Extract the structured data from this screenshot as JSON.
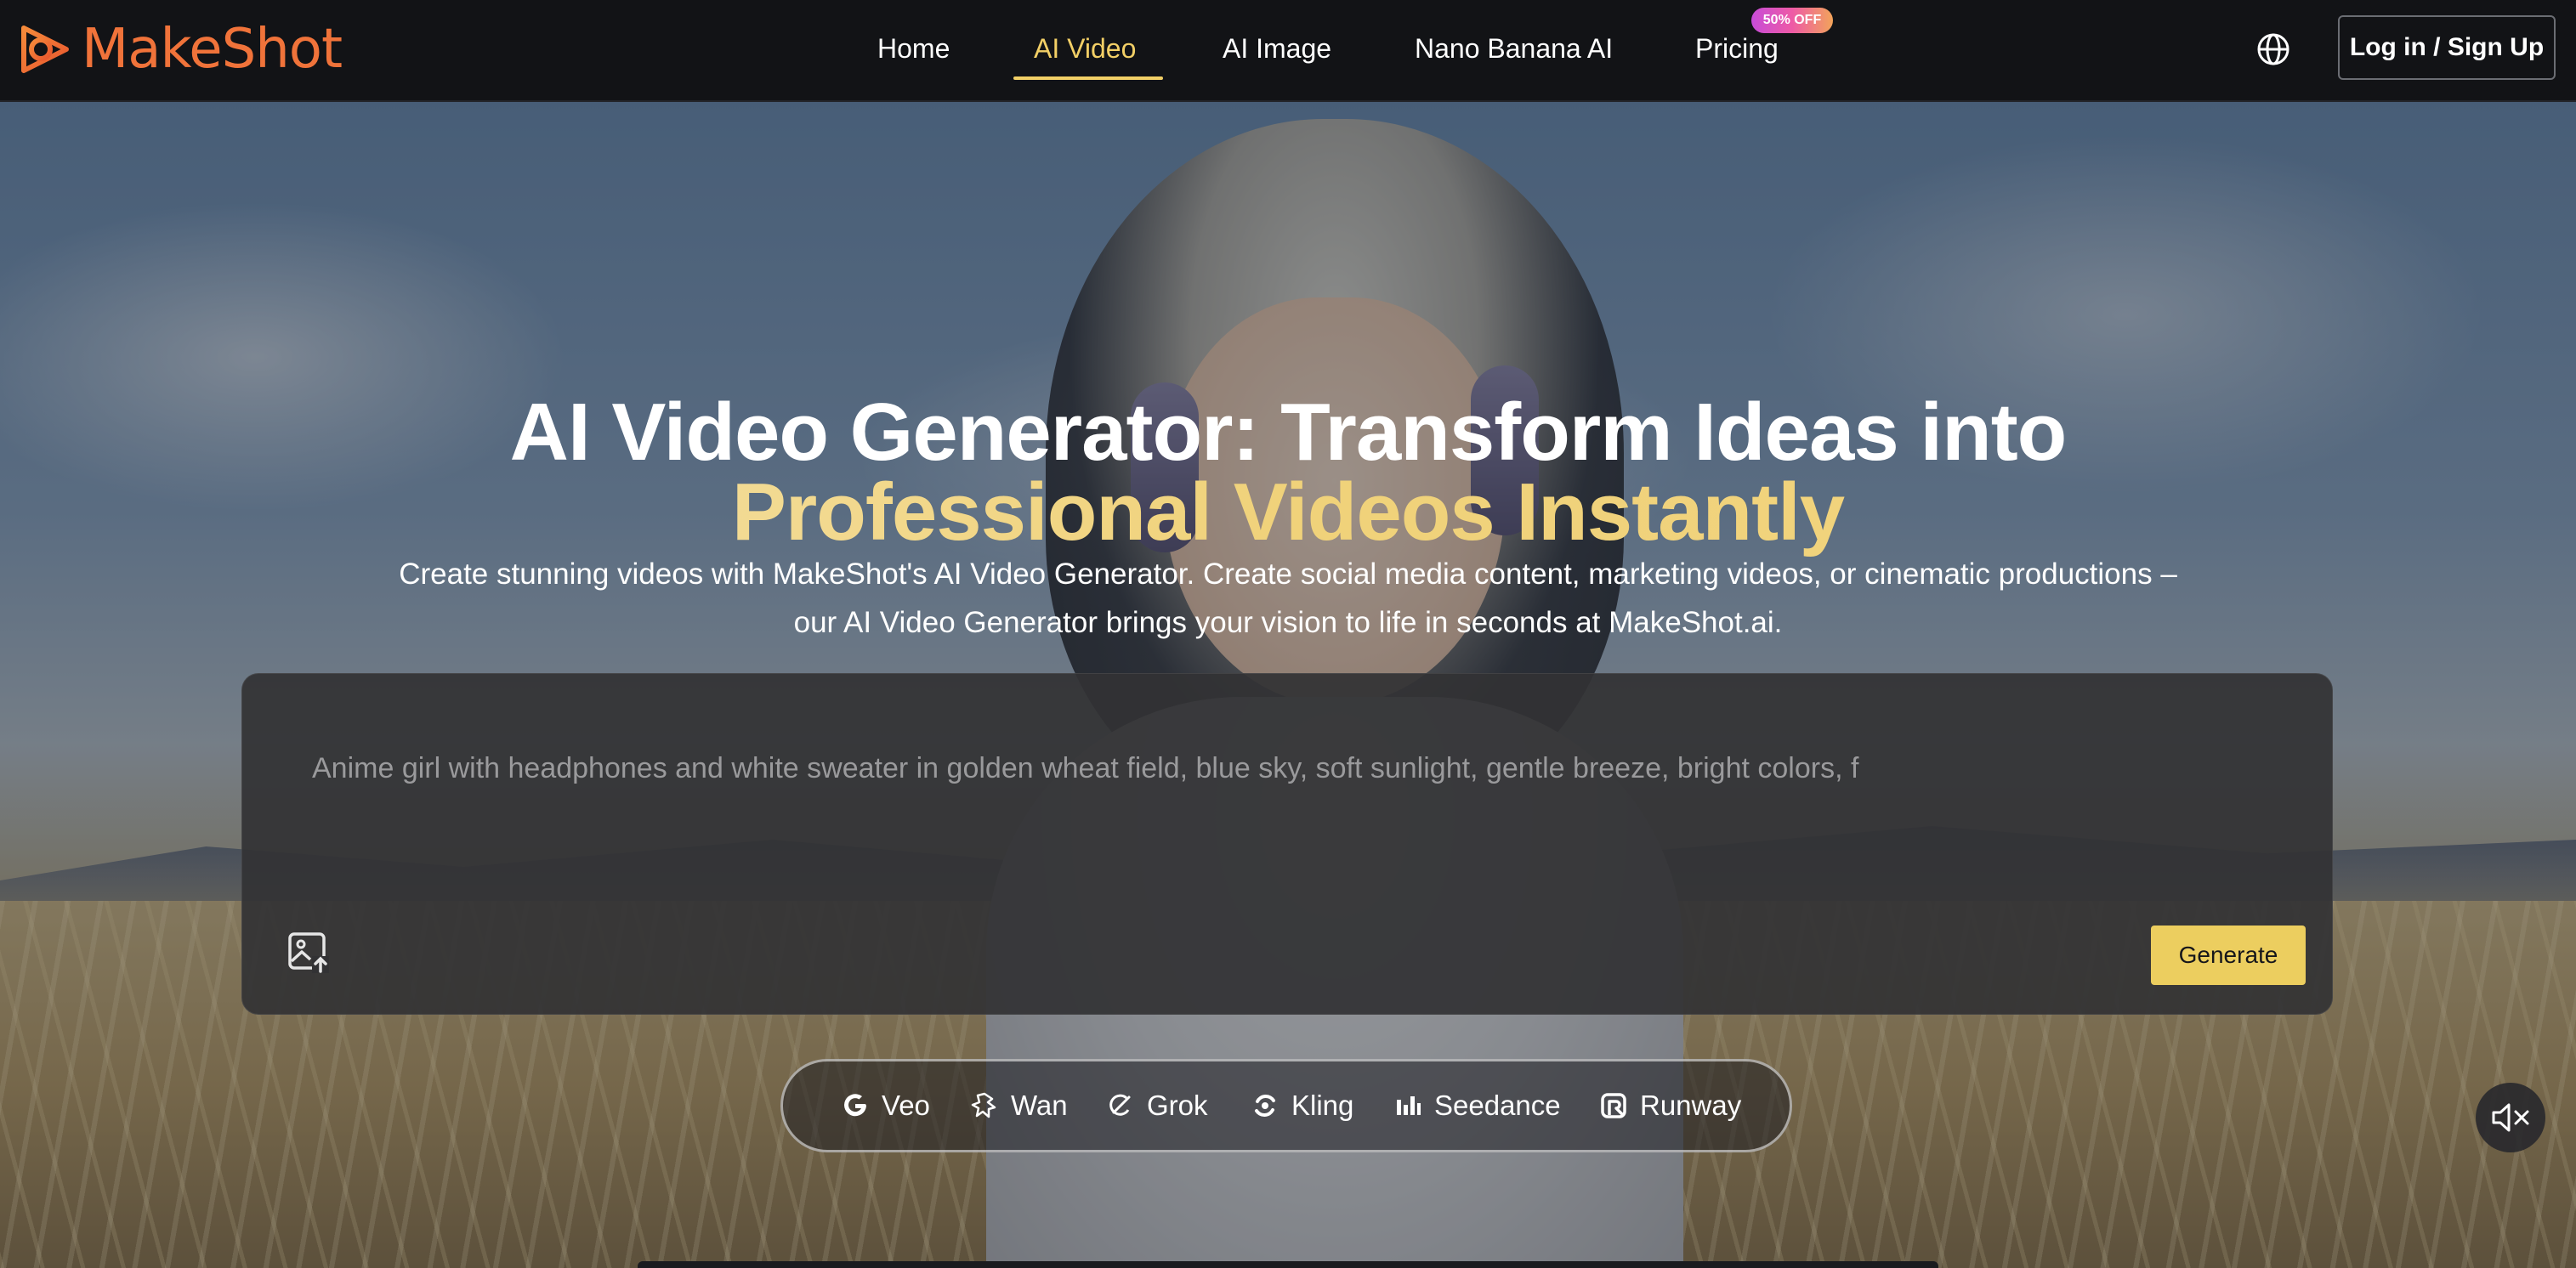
{
  "brand": {
    "name": "MakeShot"
  },
  "nav": {
    "items": [
      {
        "label": "Home"
      },
      {
        "label": "AI Video"
      },
      {
        "label": "AI Image"
      },
      {
        "label": "Nano Banana AI"
      },
      {
        "label": "Pricing"
      }
    ],
    "active": "AI Video",
    "pricing_badge": "50% OFF",
    "login_label": "Log in / Sign Up"
  },
  "hero": {
    "title_line1": "AI Video Generator: Transform Ideas into",
    "title_line2": "Professional Videos Instantly",
    "subtitle_line1": "Create stunning videos with MakeShot's AI Video Generator. Create social media content, marketing videos, or cinematic productions –",
    "subtitle_line2": "our AI Video Generator brings your vision to life in seconds at MakeShot.ai."
  },
  "prompt": {
    "placeholder": "Anime girl with headphones and white sweater in golden wheat field, blue sky, soft sunlight, gentle breeze, bright colors, f",
    "generate_label": "Generate"
  },
  "models": [
    {
      "label": "Veo",
      "icon": "google-icon"
    },
    {
      "label": "Wan",
      "icon": "wan-icon"
    },
    {
      "label": "Grok",
      "icon": "grok-icon"
    },
    {
      "label": "Kling",
      "icon": "kling-icon"
    },
    {
      "label": "Seedance",
      "icon": "seedance-icon"
    },
    {
      "label": "Runway",
      "icon": "runway-icon"
    }
  ],
  "colors": {
    "accent": "#ecce5f",
    "brand": "#f0733a",
    "nav_bg": "#121316",
    "panel_bg": "#323234"
  }
}
